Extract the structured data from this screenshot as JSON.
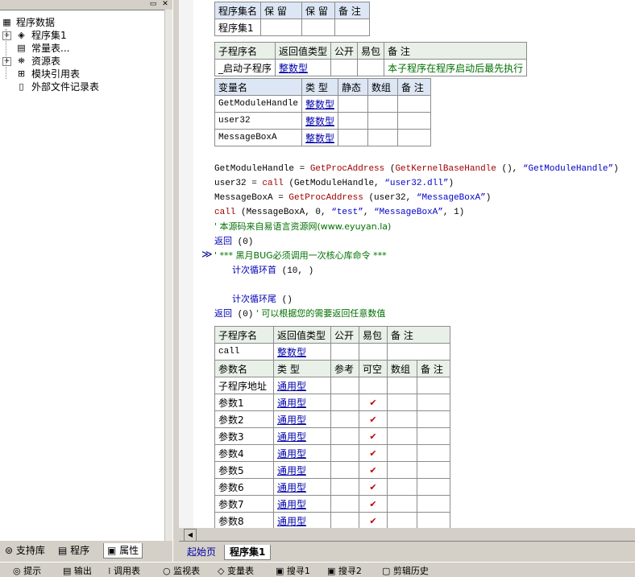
{
  "tree": {
    "root": "程序数据",
    "items": [
      {
        "label": "程序集1",
        "icon": "assembly-icon",
        "expandable": true
      },
      {
        "label": "常量表...",
        "icon": "constant-table-icon",
        "expandable": false
      },
      {
        "label": "资源表",
        "icon": "resource-table-icon",
        "expandable": true
      },
      {
        "label": "模块引用表",
        "icon": "module-reference-icon",
        "expandable": false
      },
      {
        "label": "外部文件记录表",
        "icon": "external-file-icon",
        "expandable": false
      }
    ]
  },
  "left_tabs": [
    {
      "label": "支持库",
      "icon": "support-library-icon"
    },
    {
      "label": "程序",
      "icon": "program-icon"
    },
    {
      "label": "属性",
      "icon": "properties-icon"
    }
  ],
  "assembly_table": {
    "headers": [
      "程序集名",
      "保 留",
      "保 留",
      "备 注"
    ],
    "row": [
      "程序集1",
      "",
      "",
      ""
    ]
  },
  "sub_table": {
    "headers": [
      "子程序名",
      "返回值类型",
      "公开",
      "易包",
      "备 注"
    ],
    "row": [
      "_启动子程序",
      "整数型",
      "",
      "",
      "本子程序在程序启动后最先执行"
    ]
  },
  "var_table": {
    "headers": [
      "变量名",
      "类 型",
      "静态",
      "数组",
      "备 注"
    ],
    "rows": [
      [
        "GetModuleHandle",
        "整数型",
        "",
        "",
        ""
      ],
      [
        "user32",
        "整数型",
        "",
        "",
        ""
      ],
      [
        "MessageBoxA",
        "整数型",
        "",
        "",
        ""
      ]
    ]
  },
  "code": {
    "line1": {
      "a": "GetModuleHandle = ",
      "b": "GetProcAddress",
      "c": " (",
      "d": "GetKernelBaseHandle",
      "e": " (), ",
      "f": "“GetModuleHandle”",
      "g": ")"
    },
    "line2": {
      "a": "user32 = ",
      "b": "call",
      "c": " (GetModuleHandle, ",
      "f": "“user32.dll”",
      "g": ")"
    },
    "line3": {
      "a": "MessageBoxA = ",
      "b": "GetProcAddress",
      "c": " (user32, ",
      "f": "“MessageBoxA”",
      "g": ")"
    },
    "line4": {
      "b": "call",
      "c": " (MessageBoxA, 0, ",
      "f": "“test”",
      "h": ", ",
      "i": "“MessageBoxA”",
      "j": ", 1)"
    },
    "line5": "' 本源码来自易语言资源网(www.eyuyan.la)",
    "line6": {
      "kw": "返回",
      "rest": " (0)"
    },
    "line7": "' *** 黑月BUG必须调用一次核心库命令 ***",
    "line8": {
      "kw": "计次循环首",
      "rest": " (10, )"
    },
    "line9": {
      "kw": "计次循环尾",
      "rest": " ()"
    },
    "line10": {
      "kw": "返回",
      "rest": " (0)",
      "cm": "  ' 可以根据您的需要返回任意数值"
    },
    "arrow": "≫"
  },
  "call_table": {
    "headers": [
      "子程序名",
      "返回值类型",
      "公开",
      "易包",
      "备 注"
    ],
    "row": [
      "call",
      "整数型",
      "",
      "",
      ""
    ],
    "param_headers": [
      "参数名",
      "类 型",
      "参考",
      "可空",
      "数组",
      "备 注"
    ],
    "params": [
      {
        "name": "子程序地址",
        "type": "通用型",
        "nullable": false
      },
      {
        "name": "参数1",
        "type": "通用型",
        "nullable": true
      },
      {
        "name": "参数2",
        "type": "通用型",
        "nullable": true
      },
      {
        "name": "参数3",
        "type": "通用型",
        "nullable": true
      },
      {
        "name": "参数4",
        "type": "通用型",
        "nullable": true
      },
      {
        "name": "参数5",
        "type": "通用型",
        "nullable": true
      },
      {
        "name": "参数6",
        "type": "通用型",
        "nullable": true
      },
      {
        "name": "参数7",
        "type": "通用型",
        "nullable": true
      },
      {
        "name": "参数8",
        "type": "通用型",
        "nullable": true
      }
    ],
    "check_glyph": "✔"
  },
  "editor_tabs": [
    {
      "label": "起始页",
      "active": false
    },
    {
      "label": "程序集1",
      "active": true
    }
  ],
  "bottom_bar": [
    "提示",
    "输出",
    "调用表",
    "监视表",
    "变量表",
    "搜寻1",
    "搜寻2",
    "剪辑历史"
  ],
  "colors": {
    "keyword_blue": "#0000b4",
    "comment_green": "#007000",
    "function_red": "#a00000",
    "check_red": "#c00000"
  }
}
